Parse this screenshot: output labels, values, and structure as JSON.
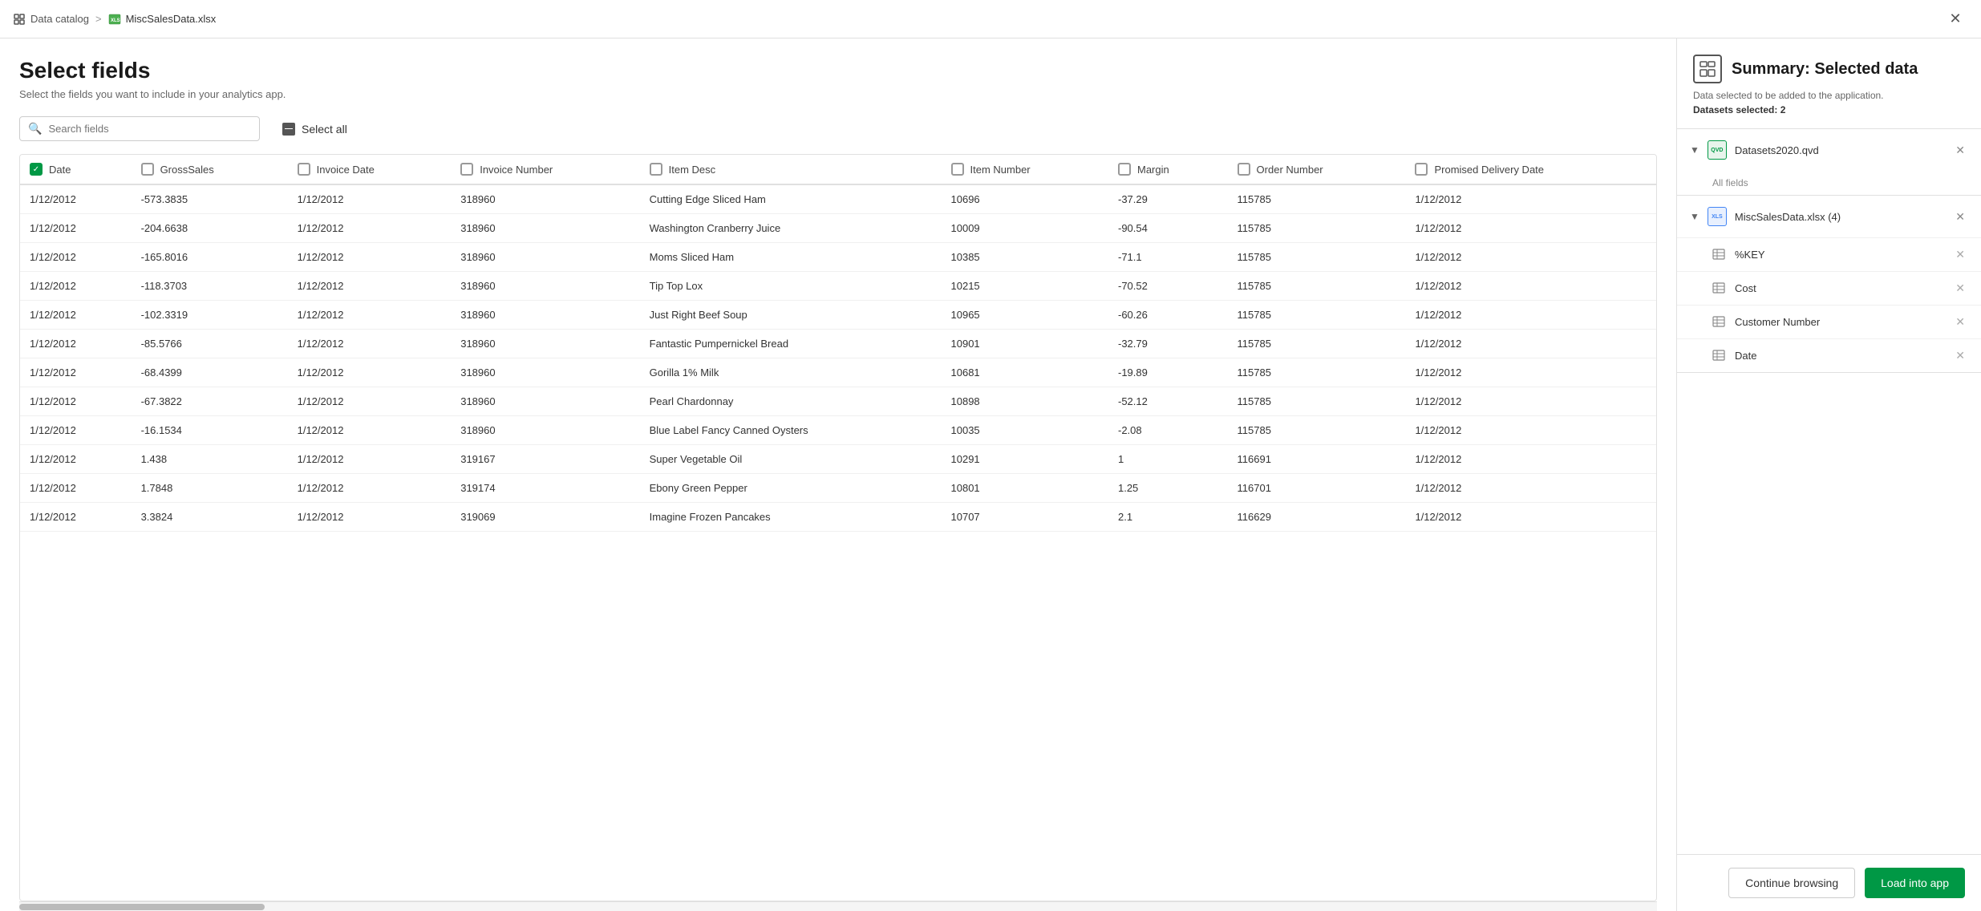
{
  "breadcrumb": {
    "home": "Data catalog",
    "separator": ">",
    "current": "MiscSalesData.xlsx"
  },
  "page": {
    "title": "Select fields",
    "subtitle": "Select the fields you want to include in your analytics app."
  },
  "toolbar": {
    "search_placeholder": "Search fields",
    "select_all_label": "Select all"
  },
  "table": {
    "columns": [
      {
        "id": "date",
        "label": "Date",
        "checked": true
      },
      {
        "id": "grossSales",
        "label": "GrossSales",
        "checked": false
      },
      {
        "id": "invoiceDate",
        "label": "Invoice Date",
        "checked": false
      },
      {
        "id": "invoiceNumber",
        "label": "Invoice Number",
        "checked": false
      },
      {
        "id": "itemDesc",
        "label": "Item Desc",
        "checked": false
      },
      {
        "id": "itemNumber",
        "label": "Item Number",
        "checked": false
      },
      {
        "id": "margin",
        "label": "Margin",
        "checked": false
      },
      {
        "id": "orderNumber",
        "label": "Order Number",
        "checked": false
      },
      {
        "id": "promisedDeliveryDate",
        "label": "Promised Delivery Date",
        "checked": false
      }
    ],
    "rows": [
      {
        "date": "1/12/2012",
        "grossSales": "-573.3835",
        "invoiceDate": "1/12/2012",
        "invoiceNumber": "318960",
        "itemDesc": "Cutting Edge Sliced Ham",
        "itemNumber": "10696",
        "margin": "-37.29",
        "orderNumber": "115785",
        "promisedDeliveryDate": "1/12/2012"
      },
      {
        "date": "1/12/2012",
        "grossSales": "-204.6638",
        "invoiceDate": "1/12/2012",
        "invoiceNumber": "318960",
        "itemDesc": "Washington Cranberry Juice",
        "itemNumber": "10009",
        "margin": "-90.54",
        "orderNumber": "115785",
        "promisedDeliveryDate": "1/12/2012"
      },
      {
        "date": "1/12/2012",
        "grossSales": "-165.8016",
        "invoiceDate": "1/12/2012",
        "invoiceNumber": "318960",
        "itemDesc": "Moms Sliced Ham",
        "itemNumber": "10385",
        "margin": "-71.1",
        "orderNumber": "115785",
        "promisedDeliveryDate": "1/12/2012"
      },
      {
        "date": "1/12/2012",
        "grossSales": "-118.3703",
        "invoiceDate": "1/12/2012",
        "invoiceNumber": "318960",
        "itemDesc": "Tip Top Lox",
        "itemNumber": "10215",
        "margin": "-70.52",
        "orderNumber": "115785",
        "promisedDeliveryDate": "1/12/2012"
      },
      {
        "date": "1/12/2012",
        "grossSales": "-102.3319",
        "invoiceDate": "1/12/2012",
        "invoiceNumber": "318960",
        "itemDesc": "Just Right Beef Soup",
        "itemNumber": "10965",
        "margin": "-60.26",
        "orderNumber": "115785",
        "promisedDeliveryDate": "1/12/2012"
      },
      {
        "date": "1/12/2012",
        "grossSales": "-85.5766",
        "invoiceDate": "1/12/2012",
        "invoiceNumber": "318960",
        "itemDesc": "Fantastic Pumpernickel Bread",
        "itemNumber": "10901",
        "margin": "-32.79",
        "orderNumber": "115785",
        "promisedDeliveryDate": "1/12/2012"
      },
      {
        "date": "1/12/2012",
        "grossSales": "-68.4399",
        "invoiceDate": "1/12/2012",
        "invoiceNumber": "318960",
        "itemDesc": "Gorilla 1% Milk",
        "itemNumber": "10681",
        "margin": "-19.89",
        "orderNumber": "115785",
        "promisedDeliveryDate": "1/12/2012"
      },
      {
        "date": "1/12/2012",
        "grossSales": "-67.3822",
        "invoiceDate": "1/12/2012",
        "invoiceNumber": "318960",
        "itemDesc": "Pearl Chardonnay",
        "itemNumber": "10898",
        "margin": "-52.12",
        "orderNumber": "115785",
        "promisedDeliveryDate": "1/12/2012"
      },
      {
        "date": "1/12/2012",
        "grossSales": "-16.1534",
        "invoiceDate": "1/12/2012",
        "invoiceNumber": "318960",
        "itemDesc": "Blue Label Fancy Canned Oysters",
        "itemNumber": "10035",
        "margin": "-2.08",
        "orderNumber": "115785",
        "promisedDeliveryDate": "1/12/2012"
      },
      {
        "date": "1/12/2012",
        "grossSales": "1.438",
        "invoiceDate": "1/12/2012",
        "invoiceNumber": "319167",
        "itemDesc": "Super Vegetable Oil",
        "itemNumber": "10291",
        "margin": "1",
        "orderNumber": "116691",
        "promisedDeliveryDate": "1/12/2012"
      },
      {
        "date": "1/12/2012",
        "grossSales": "1.7848",
        "invoiceDate": "1/12/2012",
        "invoiceNumber": "319174",
        "itemDesc": "Ebony Green Pepper",
        "itemNumber": "10801",
        "margin": "1.25",
        "orderNumber": "116701",
        "promisedDeliveryDate": "1/12/2012"
      },
      {
        "date": "1/12/2012",
        "grossSales": "3.3824",
        "invoiceDate": "1/12/2012",
        "invoiceNumber": "319069",
        "itemDesc": "Imagine Frozen Pancakes",
        "itemNumber": "10707",
        "margin": "2.1",
        "orderNumber": "116629",
        "promisedDeliveryDate": "1/12/2012"
      }
    ]
  },
  "summary": {
    "title": "Summary: Selected data",
    "description": "Data selected to be added to the application.",
    "datasets_label": "Datasets selected: 2",
    "datasets": [
      {
        "name": "Datasets2020.qvd",
        "type": "qvd",
        "expanded": true,
        "fields_label": "All fields",
        "fields": []
      },
      {
        "name": "MiscSalesData.xlsx (4)",
        "type": "xlsx",
        "expanded": true,
        "fields": [
          {
            "name": "%KEY"
          },
          {
            "name": "Cost"
          },
          {
            "name": "Customer Number"
          },
          {
            "name": "Date"
          }
        ]
      }
    ]
  },
  "footer": {
    "continue_label": "Continue browsing",
    "load_label": "Load into app"
  }
}
